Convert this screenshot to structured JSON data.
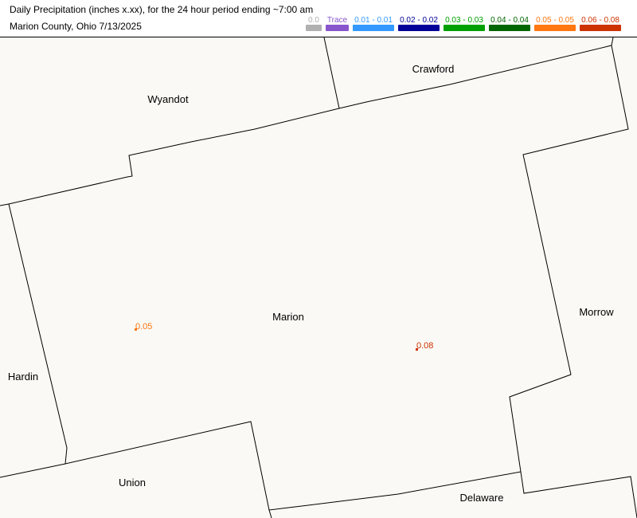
{
  "header": {
    "line1": "Daily Precipitation (inches  x.xx),  for the 24 hour period ending ~7:00 am",
    "line2": "Marion County, Ohio  7/13/2025"
  },
  "legend": [
    {
      "label": "0.0",
      "color": "#b0b0b0"
    },
    {
      "label": "Trace",
      "color": "#8855cc"
    },
    {
      "label": "0.01 - 0.01",
      "color": "#3399ff"
    },
    {
      "label": "0.02 - 0.02",
      "color": "#000099"
    },
    {
      "label": "0.03 - 0.03",
      "color": "#00a000"
    },
    {
      "label": "0.04 - 0.04",
      "color": "#006600"
    },
    {
      "label": "0.05 - 0.05",
      "color": "#ff7711"
    },
    {
      "label": "0.06 - 0.08",
      "color": "#cc3300"
    }
  ],
  "map": {
    "counties": {
      "marion": "Marion",
      "wyandot": "Wyandot",
      "crawford": "Crawford",
      "morrow": "Morrow",
      "hardin": "Hardin",
      "union": "Union",
      "delaware": "Delaware"
    },
    "observations": [
      {
        "value": "0.05",
        "color": "#ff7711"
      },
      {
        "value": "0.08",
        "color": "#cc3300"
      }
    ]
  }
}
